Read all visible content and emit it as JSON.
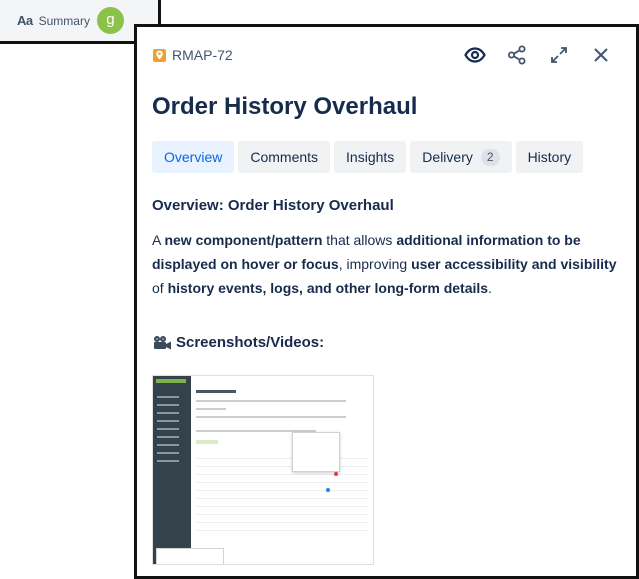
{
  "summary_field": {
    "type_icon_text": "Aa",
    "label": "Summary",
    "avatar_initial": "g",
    "avatar_color": "#8bc34a"
  },
  "card": {
    "issue_key": "RMAP-72",
    "issue_type_icon": "location-pin-icon",
    "actions": [
      "eye-icon",
      "share-icon",
      "expand-icon",
      "close-icon"
    ],
    "title": "Order History Overhaul",
    "tabs": [
      {
        "label": "Overview",
        "active": true
      },
      {
        "label": "Comments",
        "active": false
      },
      {
        "label": "Insights",
        "active": false
      },
      {
        "label": "Delivery",
        "count": "2",
        "active": false
      },
      {
        "label": "History",
        "active": false
      }
    ],
    "overview_heading": "Overview: Order History Overhaul",
    "description": {
      "p1": "A ",
      "b1": "new component/pattern",
      "p2": " that allows ",
      "b2": "additional information to be displayed on hover or focus",
      "p3": ", improving ",
      "b3": "user accessibility and visibility",
      "p4": " of ",
      "b4": "history events, logs, and other long-form details",
      "p5": "."
    },
    "screenshots_heading": "Screenshots/Videos:"
  },
  "colors": {
    "accent": "#0c66e4",
    "active_tab_bg": "#e9f2ff",
    "issue_icon": "#f0a030"
  }
}
